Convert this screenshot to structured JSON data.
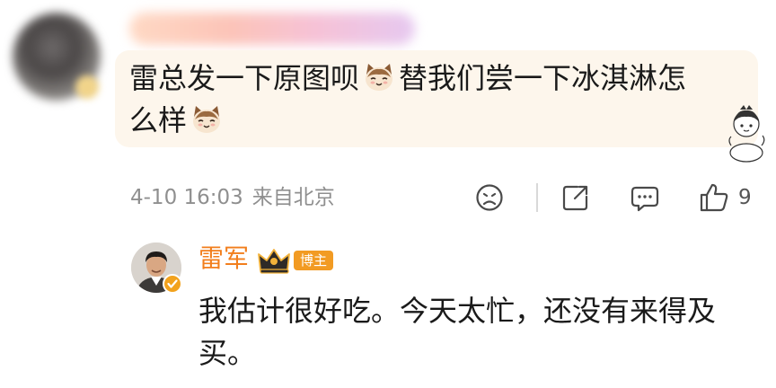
{
  "comment": {
    "text_line1_part1": "雷总发一下原图呗",
    "text_line1_part2": "替我们尝一下冰淇淋怎",
    "text_line2": "么样",
    "emoji_icon": "cat-emoji-icon",
    "bubble_color": "#fdf6ec",
    "meta": {
      "date": "4-10 16:03",
      "source": "来自北京"
    },
    "actions": {
      "like_count": "9"
    }
  },
  "reply": {
    "author": "雷军",
    "author_color": "#f27e1c",
    "badge": "博主",
    "badge_color": "#f29b23",
    "text_line1": "我估计很好吃。今天太忙，还没有来得及",
    "text_line2": "买。"
  },
  "colors": {
    "meta_text": "#8f8f8f",
    "icon_stroke": "#4a4a4a"
  }
}
